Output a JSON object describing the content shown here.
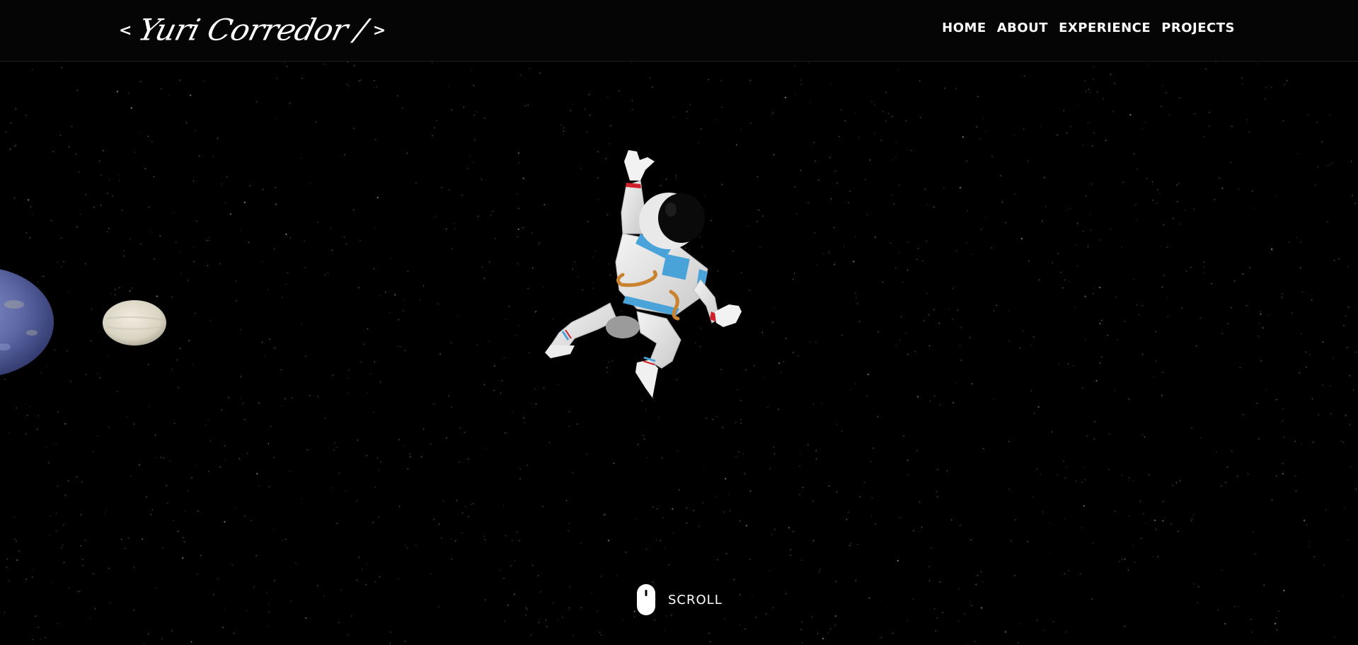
{
  "header": {
    "logo_left_bracket": "<",
    "logo_name": "Yuri Corredor /",
    "logo_right_bracket": ">"
  },
  "nav": {
    "items": [
      {
        "label": "HOME"
      },
      {
        "label": "ABOUT"
      },
      {
        "label": "EXPERIENCE"
      },
      {
        "label": "PROJECTS"
      }
    ]
  },
  "scroll": {
    "label": "SCROLL",
    "icon": "mouse-icon"
  },
  "scene": {
    "background_color": "#000000",
    "objects": [
      "astronaut",
      "planet",
      "moon"
    ]
  },
  "colors": {
    "text": "#ffffff",
    "navbar_bg": "#050505",
    "suit_accent": "#4aa3d8",
    "suit_red": "#d0202a",
    "hose": "#c9822e"
  }
}
